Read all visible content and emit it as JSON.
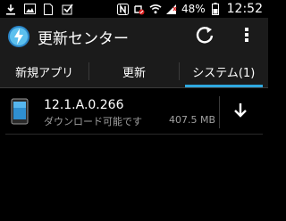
{
  "statusbar": {
    "battery": "48%",
    "time": "12:52",
    "left_icons": [
      "download-icon",
      "image-icon",
      "sim-icon",
      "check-box-icon"
    ],
    "right_icons": [
      "nfc-icon",
      "mute-icon",
      "wifi-icon",
      "signal-icon",
      "battery-icon"
    ]
  },
  "actionbar": {
    "title": "更新センター",
    "icons": [
      "update-center-icon",
      "refresh-icon",
      "overflow-menu-icon"
    ]
  },
  "tabs": [
    {
      "label": "新規アプリ",
      "active": false
    },
    {
      "label": "更新",
      "active": false
    },
    {
      "label": "システム(1)",
      "active": true
    }
  ],
  "update_item": {
    "version": "12.1.A.0.266",
    "status": "ダウンロード可能です",
    "size": "407.5 MB",
    "icon": "phone-icon",
    "action_icon": "download-arrow-icon"
  },
  "colors": {
    "accent": "#2fa9e0",
    "background": "#000000",
    "bar": "#1b1b1b",
    "secondary_text": "#a0a0a0"
  }
}
